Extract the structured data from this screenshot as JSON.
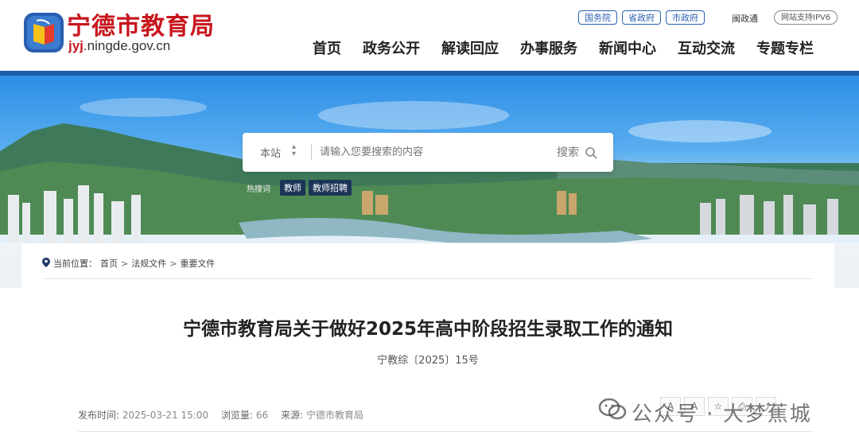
{
  "header": {
    "site_title": "宁德市教育局",
    "domain_highlight": "jyj",
    "domain_rest": ".ningde.gov.cn",
    "top_links": [
      "国务院",
      "省政府",
      "市政府"
    ],
    "minzhengtong": "闽政通",
    "ipv6": "网站支持IPV6",
    "nav": [
      "首页",
      "政务公开",
      "解读回应",
      "办事服务",
      "新闻中心",
      "互动交流",
      "专题专栏"
    ]
  },
  "search": {
    "scope": "本站",
    "placeholder": "请输入您要搜索的内容",
    "button": "搜索",
    "hot_label": "热搜词",
    "hot_tags": [
      "教师",
      "教师招聘"
    ]
  },
  "breadcrumb": {
    "label": "当前位置：",
    "items": [
      "首页",
      "法规文件",
      "重要文件"
    ],
    "separator": ">"
  },
  "article": {
    "title": "宁德市教育局关于做好2025年高中阶段招生录取工作的通知",
    "doc_number": "宁教综〔2025〕15号",
    "publish_label": "发布时间:",
    "publish_time": "2025-03-21 15:00",
    "views_label": "浏览量:",
    "views": "66",
    "source_label": "来源:",
    "source": "宁德市教育局"
  },
  "watermark": {
    "text": "公众号 · 大梦蕉城"
  },
  "colors": {
    "brand_red": "#c8161d",
    "nav_blue": "#1f5aa6",
    "pill_blue": "#2a5fb0"
  }
}
